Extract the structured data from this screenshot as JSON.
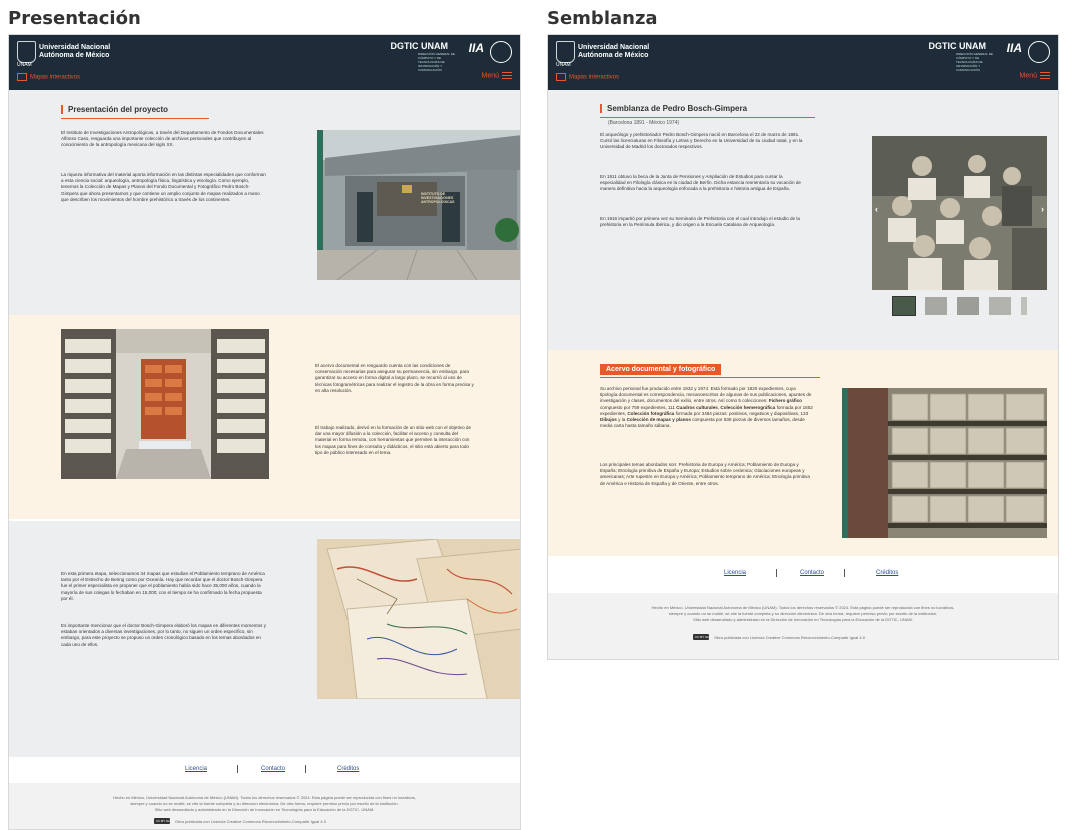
{
  "captions": {
    "left": "Presentación",
    "right": "Semblanza"
  },
  "header": {
    "university_line1": "Universidad Nacional",
    "university_line2": "Autónoma de México",
    "unam": "UNAM",
    "dgtic": "DGTIC UNAM",
    "dgtic_sub": "DIRECCIÓN GENERAL DE CÓMPUTO Y DE TECNOLOGÍAS DE INFORMACIÓN Y COMUNICACIÓN",
    "iia": "IIA",
    "maps_link": "Mapas interactivos",
    "menu": "Menú"
  },
  "presentacion": {
    "title": "Presentación del proyecto",
    "p1": "El Instituto de Investigaciones Antropológicas, a través del Departamento de Fondos Documentales Alfonso Caso, resguarda una importante colección de archivos personales que contribuyen al conocimiento de la antropología mexicana del siglo XX.",
    "p2": "La riqueza informativa del material aporta información en las distintas especialidades que conforman a esta ciencia social: arqueología, antropología física, lingüística y etnología. Como ejemplo, tenemos la Colección de Mapas y Planos del Fondo Documental y Fotográfico Pedro Bosch-Gimpera que ahora presentamos y que contiene un amplio conjunto de mapas realizados a mano que describen los movimientos del hombre prehistórico a través de los continentes.",
    "p3": "El acervo documental en resguardo cuenta con las condiciones de conservación necesarias para asegurar su permanencia, sin embargo, para garantizar su acceso en forma digital a largo plazo, se recurrió al uso de técnicas fotogramétricas para realizar el registro de la obra en forma precisa y en alta resolución.",
    "p4": "El trabajo realizado, derivó en la formación de un sitio web con el objetivo de dar una mayor difusión a la colección, facilitar el acceso y consulta del material en forma remota, con herramientas que permiten la interacción con los mapas para fines de consulta y didácticos, el sitio está abierto para todo tipo de público interesado en el tema.",
    "p5": "En esta primera etapa, seleccionamos 34 mapas que estudian el Poblamiento temprano de América tanto por el Estrecho de Bering como por Oceanía. Hay que recordar que el doctor Bosch-Gimpera fue el primer especialista en proponer que el poblamiento había sido hace 35,000 años, cuando la mayoría de sus colegas lo fechaban en 15,000; con el tiempo se ha confirmado la fecha propuesta por él.",
    "p6": "Es importante mencionar que el doctor Bosch-Gimpera elaboró los mapas en diferentes momentos y estaban orientados a diversas investigaciones, por lo tanto, no siguen un orden específico, sin embargo, para este proyecto se propuso un orden cronológico basado en los temas abordados en cada uno de ellos.",
    "building_sign": "INSTITUTO DE INVESTIGACIONES ANTROPOLÓGICAS"
  },
  "semblanza": {
    "title": "Semblanza de Pedro Bosch-Gimpera",
    "subtitle": "(Barcelona 1891 - México 1974)",
    "p1": "El arqueólogo y prehistoriador Pedro Bosch-Gimpera nació en Barcelona el 22 de marzo de 1891. Cursó las licenciaturas en Filosofía y Letras y Derecho en la Universidad de su ciudad natal, y en la Universidad de Madrid los doctorados respectivos.",
    "p2": "En 1911 obtuvo la beca de la Junta de Pensiones y Ampliación de Estudios para cursar la especialidad en Filología clásica en la ciudad de Berlín. Dicha estancia reorientaría su vocación de manera definitiva hacia la arqueología enfocada a la prehistoria e historia antigua de España.",
    "p3": "En 1916 impartió por primera vez su Seminario de Prehistoria con el cual introdujo el estudio de la prehistoria en la Península Ibérica, y dio origen a la Escuela Catalana de Arqueología.",
    "acervo_title": "Acervo documental y fotográfico",
    "a1_pre": "Su archivo personal fue producido entre 1932 y 1974. Está formado por 1820 expedientes, cuya tipología documental es correspondencia, mecanoescritos de algunas de sus publicaciones, apuntes de investigación y clases, documentos del exilio, entre otros. Así como 5 colecciones:",
    "a1_b1": "Fichero gráfico",
    "a1_m1": "compuesto por 759 expedientes, 111",
    "a1_b2": "Cuadros culturales",
    "a1_m2": ",",
    "a1_b3": "Colección hemerográfica",
    "a1_m3": "formada por 1852 expedientes,",
    "a1_b4": "Colección fotográfica",
    "a1_m4": "formada por 3484 piezas: positivos, negativos y diapositivas, 133",
    "a1_b5": "Dibujos",
    "a1_m5": "y la",
    "a1_b6": "Colección de mapas y planos",
    "a1_post": "compuesta por 838 piezas de diversos tamaños, desde media carta hasta tamaño sábana.",
    "a2": "Los principales temas abordados son: Prehistoria de Europa y América; Poblamiento de Europa y España; Etnología primitiva de España y Europa; Estudios sobre cerámica; Glaciaciones europeas y americanas; Arte rupestre en Europa y América; Poblamiento temprano de América; Etnología primitiva de América e Historia de España y de Oriente, entre otros."
  },
  "footer": {
    "licencia": "Licencia",
    "contacto": "Contacto",
    "creditos": "Créditos",
    "legal1": "Hecho en México, Universidad Nacional Autónoma de México (UNAM). Todos los derechos reservados © 2024. Esta página puede ser reproducida con fines no lucrativos,",
    "legal2": "siempre y cuando no se mutile, se cite la fuente completa y su dirección electrónica. De otra forma, requiere permiso previo por escrito de la institución.",
    "legal3": "Sitio web desarrollado y administrado en la Dirección de Innovación en Tecnologías para la Educación de la DGTIC- UNAM.",
    "cc_text": "Obra publicada con Licencia Creative Commons Reconocimiento-Compartir Igual 4.0",
    "cc_badge": "CC BY SA"
  },
  "colors": {
    "accent": "#e8582a",
    "header": "#1d2c38",
    "gray_section": "#eceeef",
    "cream_section": "#fdf3e4",
    "link": "#2a4f8a"
  }
}
